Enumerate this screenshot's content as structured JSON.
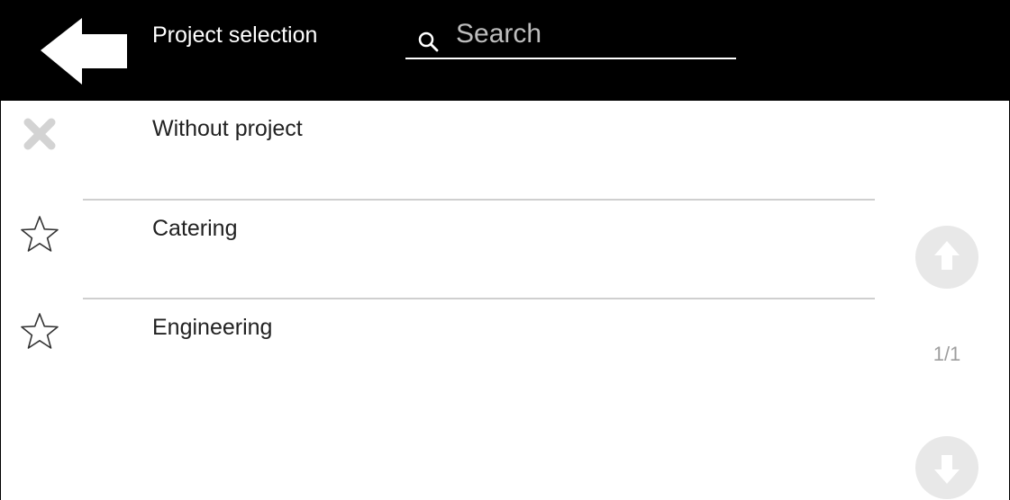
{
  "header": {
    "title": "Project selection",
    "back_icon": "arrow-left-icon"
  },
  "search": {
    "placeholder": "Search",
    "value": "",
    "icon": "search-icon"
  },
  "projects": [
    {
      "label": "Without project",
      "icon": "close-icon"
    },
    {
      "label": "Catering",
      "icon": "star-outline-icon"
    },
    {
      "label": "Engineering",
      "icon": "star-outline-icon"
    }
  ],
  "pagination": {
    "current": "1/1",
    "up_icon": "arrow-up-circle-icon",
    "down_icon": "arrow-down-circle-icon"
  },
  "colors": {
    "header_bg": "#000000",
    "header_text": "#ffffff",
    "divider": "#cfcfcf",
    "muted_icon": "#d3d3d3",
    "pager_button": "#e8e8e8"
  }
}
